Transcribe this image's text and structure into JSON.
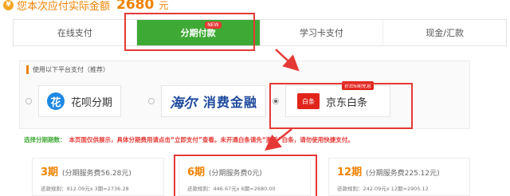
{
  "header": {
    "label": "您本次应付实际金额",
    "amount": "2680",
    "unit": "元",
    "icon": "yen-icon"
  },
  "tabs": [
    {
      "label": "在线支付",
      "active": false
    },
    {
      "label": "分期付款",
      "active": true,
      "badge": "NEW"
    },
    {
      "label": "学习卡支付",
      "active": false
    },
    {
      "label": "现金/汇款",
      "active": false
    }
  ],
  "platforms": {
    "heading": "使用以下平台支付（推荐）",
    "options": [
      {
        "name": "花呗分期",
        "logo": "花",
        "selected": false
      },
      {
        "name": "消费金融",
        "logo": "海尔",
        "selected": false
      },
      {
        "name": "京东白条",
        "logo": "白条",
        "promo": "折后6期免息",
        "selected": true
      }
    ]
  },
  "notice": {
    "lead": "选择分期期数：",
    "message": "本页面仅供展示，具体分期费用请点击“立即支付”查看。未开通白条请先“激活”白条，请勿使用快捷支付。"
  },
  "periods": [
    {
      "num": "3期",
      "fee": "(分期服务费56.28元)",
      "detail": "还款规则：912.09元x 3期=2736.28"
    },
    {
      "num": "6期",
      "fee": "(分期服务费0元)",
      "detail": "还款规则：446.67元x 6期=2680.00"
    },
    {
      "num": "12期",
      "fee": "(分期服务费225.12元)",
      "detail": "还款规则：242.09元x 12期=2905.12"
    }
  ],
  "colors": {
    "accent_green": "#3fa935",
    "highlight_red": "#e53935",
    "amount_orange": "#f08200"
  }
}
